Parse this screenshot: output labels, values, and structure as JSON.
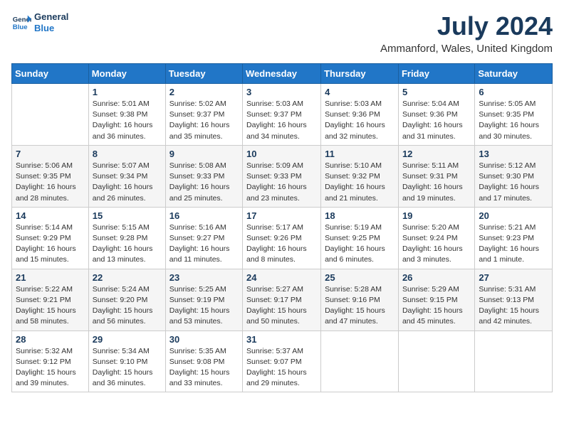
{
  "logo": {
    "line1": "General",
    "line2": "Blue"
  },
  "title": "July 2024",
  "location": "Ammanford, Wales, United Kingdom",
  "days_header": [
    "Sunday",
    "Monday",
    "Tuesday",
    "Wednesday",
    "Thursday",
    "Friday",
    "Saturday"
  ],
  "weeks": [
    [
      {
        "num": "",
        "info": ""
      },
      {
        "num": "1",
        "info": "Sunrise: 5:01 AM\nSunset: 9:38 PM\nDaylight: 16 hours\nand 36 minutes."
      },
      {
        "num": "2",
        "info": "Sunrise: 5:02 AM\nSunset: 9:37 PM\nDaylight: 16 hours\nand 35 minutes."
      },
      {
        "num": "3",
        "info": "Sunrise: 5:03 AM\nSunset: 9:37 PM\nDaylight: 16 hours\nand 34 minutes."
      },
      {
        "num": "4",
        "info": "Sunrise: 5:03 AM\nSunset: 9:36 PM\nDaylight: 16 hours\nand 32 minutes."
      },
      {
        "num": "5",
        "info": "Sunrise: 5:04 AM\nSunset: 9:36 PM\nDaylight: 16 hours\nand 31 minutes."
      },
      {
        "num": "6",
        "info": "Sunrise: 5:05 AM\nSunset: 9:35 PM\nDaylight: 16 hours\nand 30 minutes."
      }
    ],
    [
      {
        "num": "7",
        "info": "Sunrise: 5:06 AM\nSunset: 9:35 PM\nDaylight: 16 hours\nand 28 minutes."
      },
      {
        "num": "8",
        "info": "Sunrise: 5:07 AM\nSunset: 9:34 PM\nDaylight: 16 hours\nand 26 minutes."
      },
      {
        "num": "9",
        "info": "Sunrise: 5:08 AM\nSunset: 9:33 PM\nDaylight: 16 hours\nand 25 minutes."
      },
      {
        "num": "10",
        "info": "Sunrise: 5:09 AM\nSunset: 9:33 PM\nDaylight: 16 hours\nand 23 minutes."
      },
      {
        "num": "11",
        "info": "Sunrise: 5:10 AM\nSunset: 9:32 PM\nDaylight: 16 hours\nand 21 minutes."
      },
      {
        "num": "12",
        "info": "Sunrise: 5:11 AM\nSunset: 9:31 PM\nDaylight: 16 hours\nand 19 minutes."
      },
      {
        "num": "13",
        "info": "Sunrise: 5:12 AM\nSunset: 9:30 PM\nDaylight: 16 hours\nand 17 minutes."
      }
    ],
    [
      {
        "num": "14",
        "info": "Sunrise: 5:14 AM\nSunset: 9:29 PM\nDaylight: 16 hours\nand 15 minutes."
      },
      {
        "num": "15",
        "info": "Sunrise: 5:15 AM\nSunset: 9:28 PM\nDaylight: 16 hours\nand 13 minutes."
      },
      {
        "num": "16",
        "info": "Sunrise: 5:16 AM\nSunset: 9:27 PM\nDaylight: 16 hours\nand 11 minutes."
      },
      {
        "num": "17",
        "info": "Sunrise: 5:17 AM\nSunset: 9:26 PM\nDaylight: 16 hours\nand 8 minutes."
      },
      {
        "num": "18",
        "info": "Sunrise: 5:19 AM\nSunset: 9:25 PM\nDaylight: 16 hours\nand 6 minutes."
      },
      {
        "num": "19",
        "info": "Sunrise: 5:20 AM\nSunset: 9:24 PM\nDaylight: 16 hours\nand 3 minutes."
      },
      {
        "num": "20",
        "info": "Sunrise: 5:21 AM\nSunset: 9:23 PM\nDaylight: 16 hours\nand 1 minute."
      }
    ],
    [
      {
        "num": "21",
        "info": "Sunrise: 5:22 AM\nSunset: 9:21 PM\nDaylight: 15 hours\nand 58 minutes."
      },
      {
        "num": "22",
        "info": "Sunrise: 5:24 AM\nSunset: 9:20 PM\nDaylight: 15 hours\nand 56 minutes."
      },
      {
        "num": "23",
        "info": "Sunrise: 5:25 AM\nSunset: 9:19 PM\nDaylight: 15 hours\nand 53 minutes."
      },
      {
        "num": "24",
        "info": "Sunrise: 5:27 AM\nSunset: 9:17 PM\nDaylight: 15 hours\nand 50 minutes."
      },
      {
        "num": "25",
        "info": "Sunrise: 5:28 AM\nSunset: 9:16 PM\nDaylight: 15 hours\nand 47 minutes."
      },
      {
        "num": "26",
        "info": "Sunrise: 5:29 AM\nSunset: 9:15 PM\nDaylight: 15 hours\nand 45 minutes."
      },
      {
        "num": "27",
        "info": "Sunrise: 5:31 AM\nSunset: 9:13 PM\nDaylight: 15 hours\nand 42 minutes."
      }
    ],
    [
      {
        "num": "28",
        "info": "Sunrise: 5:32 AM\nSunset: 9:12 PM\nDaylight: 15 hours\nand 39 minutes."
      },
      {
        "num": "29",
        "info": "Sunrise: 5:34 AM\nSunset: 9:10 PM\nDaylight: 15 hours\nand 36 minutes."
      },
      {
        "num": "30",
        "info": "Sunrise: 5:35 AM\nSunset: 9:08 PM\nDaylight: 15 hours\nand 33 minutes."
      },
      {
        "num": "31",
        "info": "Sunrise: 5:37 AM\nSunset: 9:07 PM\nDaylight: 15 hours\nand 29 minutes."
      },
      {
        "num": "",
        "info": ""
      },
      {
        "num": "",
        "info": ""
      },
      {
        "num": "",
        "info": ""
      }
    ]
  ]
}
